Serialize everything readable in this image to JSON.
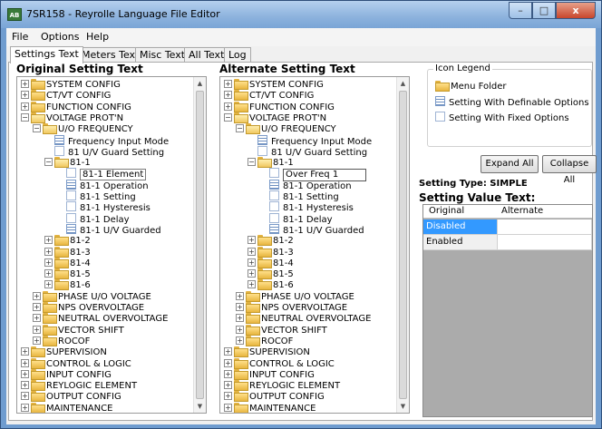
{
  "window": {
    "title": "7SR158 - Reyrolle Language File Editor",
    "app_icon_text": "AB",
    "controls": {
      "minimize": "–",
      "maximize": "□",
      "close": "x"
    }
  },
  "menu": [
    "File",
    "Options",
    "Help"
  ],
  "tabs": [
    "Settings Text",
    "Meters Text",
    "Misc Text",
    "All Text",
    "Log"
  ],
  "active_tab": "Settings Text",
  "original_header": "Original Setting Text",
  "alternate_header": "Alternate Setting Text",
  "tree_original": [
    "SYSTEM CONFIG",
    "CT/VT CONFIG",
    "FUNCTION CONFIG",
    "VOLTAGE PROT'N",
    "U/O FREQUENCY",
    "Frequency Input Mode",
    "81 U/V Guard Setting",
    "81-1",
    "81-1 Element",
    "81-1 Operation",
    "81-1 Setting",
    "81-1 Hysteresis",
    "81-1 Delay",
    "81-1 U/V Guarded",
    "81-2",
    "81-3",
    "81-4",
    "81-5",
    "81-6",
    "PHASE U/O VOLTAGE",
    "NPS OVERVOLTAGE",
    "NEUTRAL OVERVOLTAGE",
    "VECTOR SHIFT",
    "ROCOF",
    "SUPERVISION",
    "CONTROL & LOGIC",
    "INPUT CONFIG",
    "REYLOGIC ELEMENT",
    "OUTPUT CONFIG",
    "MAINTENANCE"
  ],
  "tree_alternate": [
    "SYSTEM CONFIG",
    "CT/VT CONFIG",
    "FUNCTION CONFIG",
    "VOLTAGE PROT'N",
    "U/O FREQUENCY",
    "Frequency Input Mode",
    "81 U/V Guard Setting",
    "81-1",
    "Over Freq 1",
    "81-1 Operation",
    "81-1 Setting",
    "81-1 Hysteresis",
    "81-1 Delay",
    "81-1 U/V Guarded",
    "81-2",
    "81-3",
    "81-4",
    "81-5",
    "81-6",
    "PHASE U/O VOLTAGE",
    "NPS OVERVOLTAGE",
    "NEUTRAL OVERVOLTAGE",
    "VECTOR SHIFT",
    "ROCOF",
    "SUPERVISION",
    "CONTROL & LOGIC",
    "INPUT CONFIG",
    "REYLOGIC ELEMENT",
    "OUTPUT CONFIG",
    "MAINTENANCE"
  ],
  "legend": {
    "title": "Icon Legend",
    "menu_folder": "Menu Folder",
    "definable": "Setting With Definable Options",
    "fixed": "Setting With Fixed Options"
  },
  "buttons": {
    "expand_all": "Expand All",
    "collapse_all": "Collapse All"
  },
  "setting_type": "Setting Type: SIMPLE",
  "setting_value_label": "Setting Value Text:",
  "grid": {
    "headers": [
      "Original",
      "Alternate"
    ],
    "rows": [
      [
        "Disabled",
        ""
      ],
      [
        "Enabled",
        ""
      ]
    ]
  },
  "colors": {
    "selection": "#3399ff",
    "window_frame": "#6f9ccf",
    "folder": "#e8b640"
  }
}
